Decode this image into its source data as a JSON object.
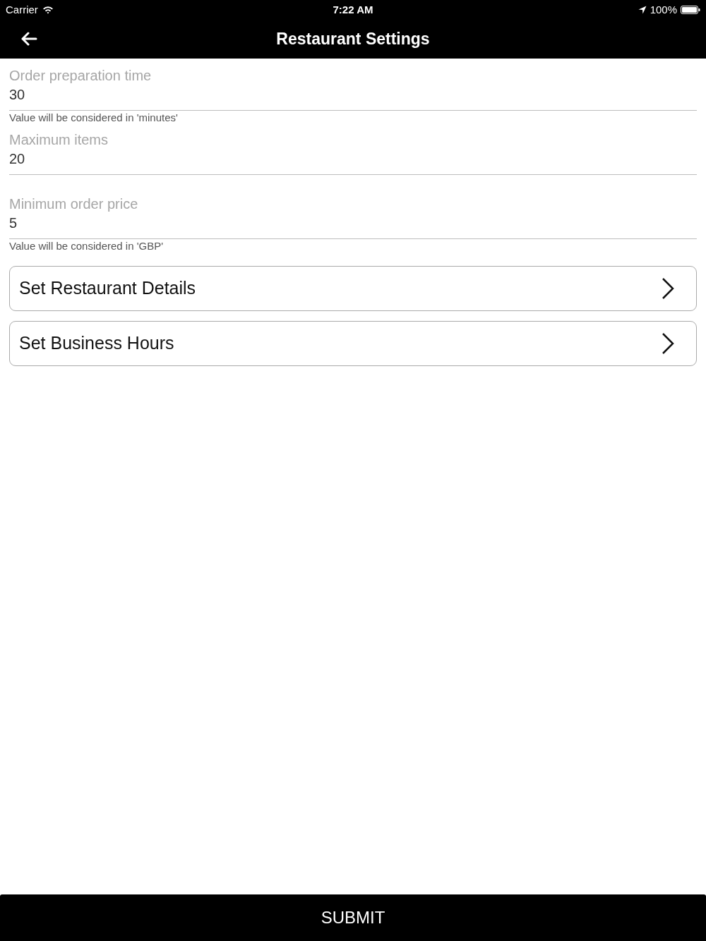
{
  "status_bar": {
    "carrier": "Carrier",
    "time": "7:22 AM",
    "battery": "100%"
  },
  "nav_bar": {
    "title": "Restaurant Settings"
  },
  "fields": [
    {
      "label": "Order preparation time",
      "value": "30",
      "hint": "Value will be considered in 'minutes'"
    },
    {
      "label": "Maximum items",
      "value": "20"
    },
    {
      "label": "Minimum order price",
      "value": "5",
      "hint": "Value will be considered in 'GBP'"
    }
  ],
  "links": [
    {
      "label": "Set Restaurant Details"
    },
    {
      "label": "Set Business Hours"
    }
  ],
  "submit_button": {
    "label": "SUBMIT"
  }
}
